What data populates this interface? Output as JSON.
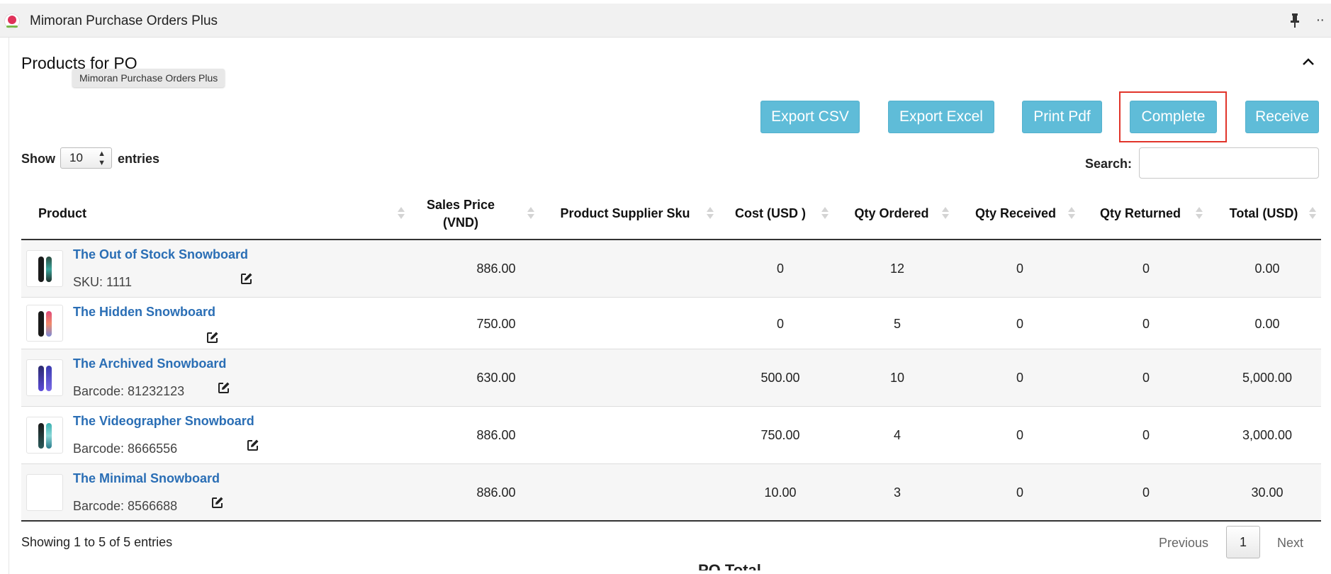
{
  "app": {
    "title": "Mimoran Purchase Orders Plus",
    "more": "··"
  },
  "section": {
    "title": "Products for PO",
    "tooltip": "Mimoran Purchase Orders Plus"
  },
  "actions": {
    "export_csv": "Export CSV",
    "export_excel": "Export Excel",
    "print_pdf": "Print Pdf",
    "complete": "Complete",
    "receive": "Receive"
  },
  "length": {
    "show": "Show",
    "value": "10",
    "entries": "entries"
  },
  "search": {
    "label": "Search:",
    "value": ""
  },
  "table": {
    "headers": {
      "product": "Product",
      "sales_price_line1": "Sales Price",
      "sales_price_line2": "(VND)",
      "supplier_sku": "Product Supplier Sku",
      "cost": "Cost (USD )",
      "qty_ordered": "Qty Ordered",
      "qty_received": "Qty Received",
      "qty_returned": "Qty Returned",
      "total": "Total (USD)"
    },
    "rows": [
      {
        "name": "The Out of Stock Snowboard",
        "meta": "SKU: 1111",
        "sales_price": "886.00",
        "supplier_sku": "",
        "cost": "0",
        "qty_ordered": "12",
        "qty_received": "0",
        "qty_returned": "0",
        "total": "0.00"
      },
      {
        "name": "The Hidden Snowboard",
        "meta": "",
        "sales_price": "750.00",
        "supplier_sku": "",
        "cost": "0",
        "qty_ordered": "5",
        "qty_received": "0",
        "qty_returned": "0",
        "total": "0.00"
      },
      {
        "name": "The Archived Snowboard",
        "meta": "Barcode: 81232123",
        "sales_price": "630.00",
        "supplier_sku": "",
        "cost": "500.00",
        "qty_ordered": "10",
        "qty_received": "0",
        "qty_returned": "0",
        "total": "5,000.00"
      },
      {
        "name": "The Videographer Snowboard",
        "meta": "Barcode: 8666556",
        "sales_price": "886.00",
        "supplier_sku": "",
        "cost": "750.00",
        "qty_ordered": "4",
        "qty_received": "0",
        "qty_returned": "0",
        "total": "3,000.00"
      },
      {
        "name": "The Minimal Snowboard",
        "meta": "Barcode: 8566688",
        "sales_price": "886.00",
        "supplier_sku": "",
        "cost": "10.00",
        "qty_ordered": "3",
        "qty_received": "0",
        "qty_returned": "0",
        "total": "30.00"
      }
    ]
  },
  "footer": {
    "info": "Showing 1 to 5 of 5 entries",
    "previous": "Previous",
    "page": "1",
    "next": "Next",
    "partial_heading": "PO Total"
  },
  "colors": {
    "button": "#5fbcd8",
    "highlight": "#e1342a",
    "link": "#2a6eb5"
  }
}
